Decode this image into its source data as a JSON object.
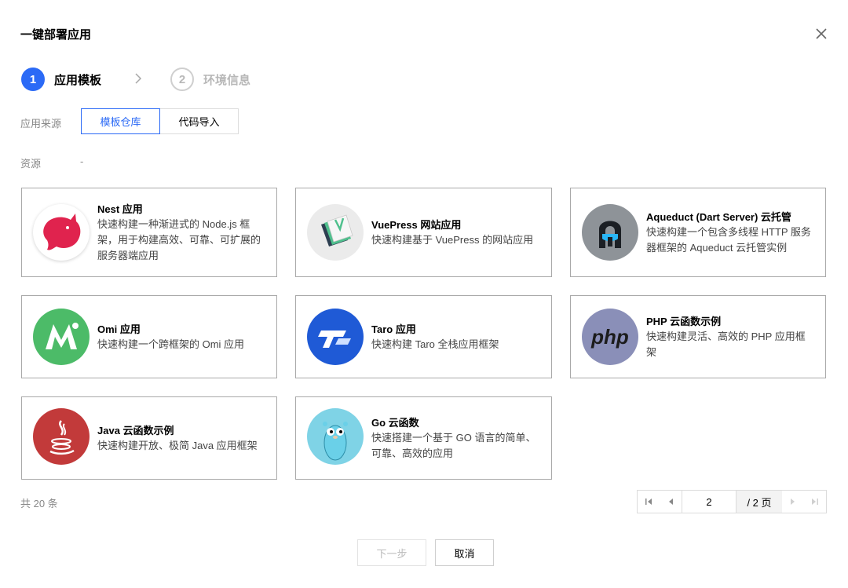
{
  "dialog": {
    "title": "一键部署应用",
    "close_icon": "close-icon"
  },
  "steps": [
    {
      "num": "1",
      "label": "应用模板",
      "active": true
    },
    {
      "num": "2",
      "label": "环境信息",
      "active": false
    }
  ],
  "source": {
    "label": "应用来源",
    "options": [
      "模板仓库",
      "代码导入"
    ],
    "selected": "模板仓库"
  },
  "resource": {
    "label": "资源",
    "value": "-"
  },
  "cards": [
    {
      "name": "Nest 应用",
      "desc": "快速构建一种渐进式的 Node.js 框架，用于构建高效、可靠、可扩展的服务器端应用",
      "icon": "nest-logo-icon"
    },
    {
      "name": "VuePress 网站应用",
      "desc": "快速构建基于 VuePress 的网站应用",
      "icon": "vuepress-logo-icon"
    },
    {
      "name": "Aqueduct (Dart Server) 云托管",
      "desc": "快速构建一个包含多线程 HTTP 服务器框架的 Aqueduct 云托管实例",
      "icon": "aqueduct-logo-icon"
    },
    {
      "name": "Omi 应用",
      "desc": "快速构建一个跨框架的 Omi 应用",
      "icon": "omi-logo-icon"
    },
    {
      "name": "Taro 应用",
      "desc": "快速构建 Taro 全栈应用框架",
      "icon": "taro-logo-icon"
    },
    {
      "name": "PHP 云函数示例",
      "desc": "快速构建灵活、高效的 PHP 应用框架",
      "icon": "php-logo-icon",
      "logo_text": "php"
    },
    {
      "name": "Java 云函数示例",
      "desc": "快速构建开放、极简 Java 应用框架",
      "icon": "java-logo-icon"
    },
    {
      "name": "Go 云函数",
      "desc": "快速搭建一个基于 GO 语言的简单、可靠、高效的应用",
      "icon": "go-gopher-icon"
    }
  ],
  "pagination": {
    "total_text": "共 20 条",
    "current_page": "2",
    "total_pages_text": "/ 2 页"
  },
  "footer": {
    "next_label": "下一步",
    "cancel_label": "取消"
  },
  "colors": {
    "accent": "#2b6af6",
    "card_border": "#a9a9a9"
  }
}
